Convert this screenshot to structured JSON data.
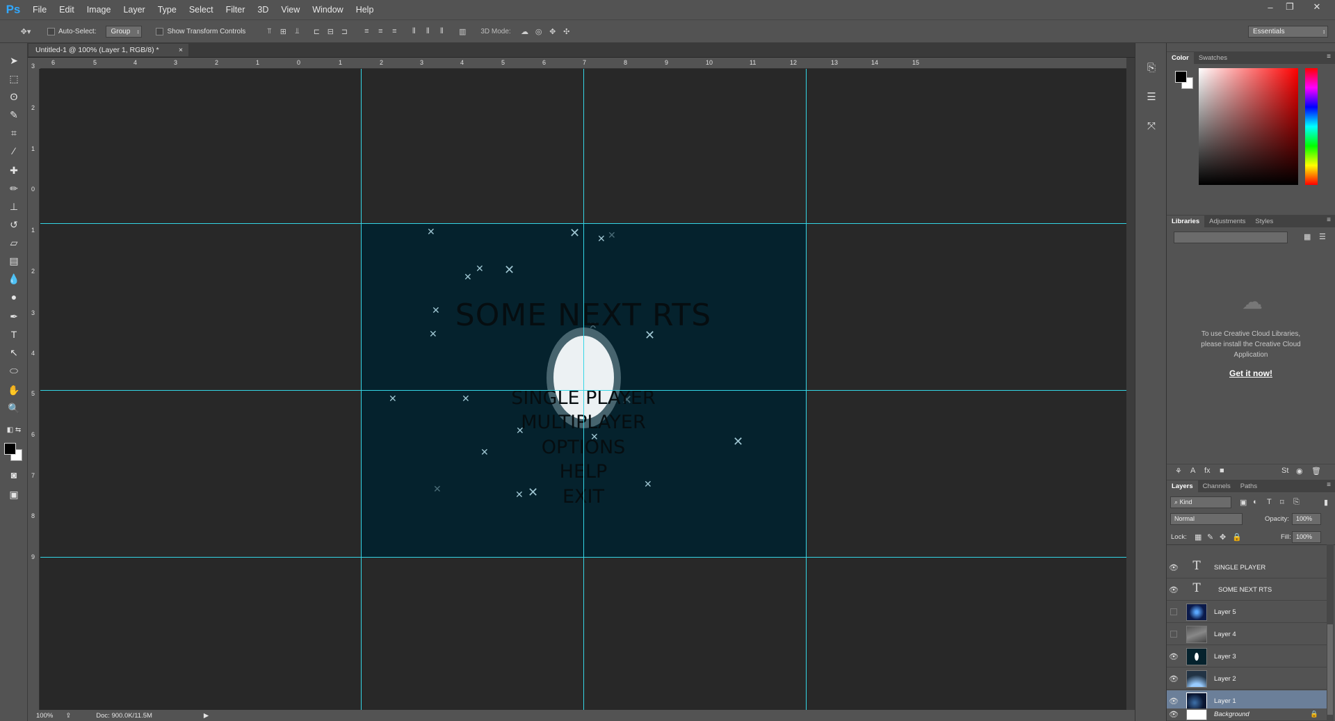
{
  "app": {
    "logo": "Ps",
    "menus": [
      "File",
      "Edit",
      "Image",
      "Layer",
      "Type",
      "Select",
      "Filter",
      "3D",
      "View",
      "Window",
      "Help"
    ],
    "window_controls": [
      "–",
      "❐",
      "✕"
    ]
  },
  "options_bar": {
    "auto_select_label": "Auto-Select:",
    "auto_select_value": "Group",
    "show_transform_label": "Show Transform Controls",
    "mode_3d_label": "3D Mode:",
    "workspace_value": "Essentials"
  },
  "document": {
    "tab_title": "Untitled-1 @ 100% (Layer 1, RGB/8) *",
    "tab_close": "×",
    "zoom": "100%",
    "doc_size": "Doc: 900.0K/11.5M"
  },
  "rulers": {
    "horizontal": [
      "6",
      "5",
      "4",
      "3",
      "2",
      "1",
      "0",
      "1",
      "2",
      "3",
      "4",
      "5",
      "6",
      "7",
      "8",
      "9",
      "10",
      "11",
      "12",
      "13",
      "14",
      "15"
    ],
    "vertical": [
      "3",
      "2",
      "1",
      "0",
      "1",
      "2",
      "3",
      "4",
      "5",
      "6",
      "7",
      "8",
      "9"
    ]
  },
  "artwork": {
    "title": "SOME NEXT RTS",
    "menu_options": [
      "SINGLE PLAYER",
      "MULTIPLAYER",
      "OPTIONS",
      "HELP",
      "EXIT"
    ],
    "background_color": "#05222d",
    "planet_color": "#ecf1f3"
  },
  "color_panel": {
    "tabs": [
      "Color",
      "Swatches"
    ],
    "foreground": "#000000",
    "background": "#ffffff"
  },
  "libraries_panel": {
    "tabs": [
      "Libraries",
      "Adjustments",
      "Styles"
    ],
    "message": "To use Creative Cloud Libraries, please install the Creative Cloud Application",
    "link": "Get it now!"
  },
  "layers_panel": {
    "tabs": [
      "Layers",
      "Channels",
      "Paths"
    ],
    "kind_label": "Kind",
    "blend_mode": "Normal",
    "opacity_label": "Opacity:",
    "opacity_value": "100%",
    "lock_label": "Lock:",
    "fill_label": "Fill:",
    "fill_value": "100%",
    "layers": [
      {
        "name": "SINGLE PLAYER",
        "type": "text",
        "visible": true,
        "selected": false
      },
      {
        "name": "SOME NEXT RTS",
        "type": "text",
        "visible": true,
        "selected": false
      },
      {
        "name": "Layer 5",
        "type": "image",
        "visible": false,
        "selected": false
      },
      {
        "name": "Layer 4",
        "type": "image",
        "visible": false,
        "selected": false
      },
      {
        "name": "Layer 3",
        "type": "image",
        "visible": true,
        "selected": false
      },
      {
        "name": "Layer 2",
        "type": "image",
        "visible": true,
        "selected": false
      },
      {
        "name": "Layer 1",
        "type": "image",
        "visible": true,
        "selected": true
      },
      {
        "name": "Background",
        "type": "background",
        "visible": true,
        "selected": false
      }
    ]
  },
  "colors": {
    "guide": "#34d6e6",
    "selected_layer": "#6b7f99"
  }
}
